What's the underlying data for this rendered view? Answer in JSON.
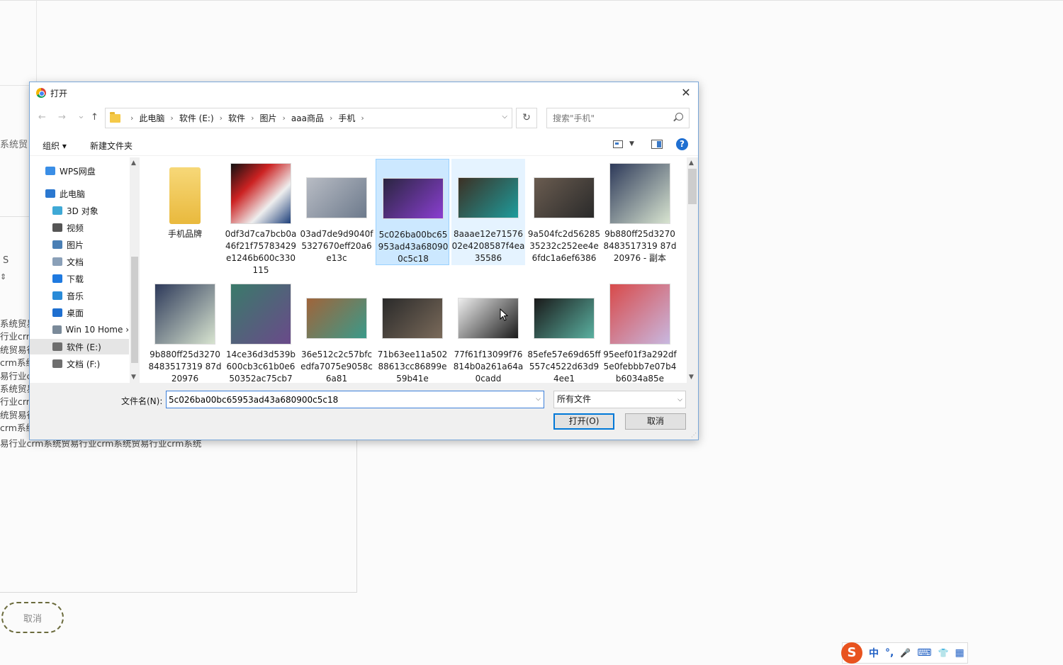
{
  "background": {
    "label_top": "系统贸",
    "s_icon": "S",
    "arrow_icon": "⇕",
    "text_lines": [
      "系统贸易",
      "行业crm",
      "统贸易行",
      "crm系统",
      "易行业c",
      "系统贸易",
      "行业crm",
      "统贸易行",
      "crm系统"
    ],
    "text_full": "易行业crm系统贸易行业crm系统贸易行业crm系统",
    "cancel": "取消"
  },
  "dialog": {
    "title": "打开",
    "close": "✕",
    "nav": {
      "back": "←",
      "forward": "→",
      "recent": "⌄",
      "up": "↑"
    },
    "breadcrumbs": [
      "此电脑",
      "软件 (E:)",
      "软件",
      "图片",
      "aaa商品",
      "手机"
    ],
    "search_placeholder": "搜索\"手机\"",
    "toolbar": {
      "organize": "组织 ▾",
      "new_folder": "新建文件夹",
      "help": "?"
    },
    "nav_pane": [
      {
        "label": "WPS网盘",
        "icon": "cloud-icon",
        "color": "#3a8ee6"
      },
      {
        "label": "此电脑",
        "icon": "computer-icon",
        "color": "#2b78d0"
      },
      {
        "label": "3D 对象",
        "icon": "3d-objects-icon",
        "color": "#3fa9d6"
      },
      {
        "label": "视频",
        "icon": "video-icon",
        "color": "#555555"
      },
      {
        "label": "图片",
        "icon": "pictures-icon",
        "color": "#4a7fb5"
      },
      {
        "label": "文档",
        "icon": "documents-icon",
        "color": "#8aa0b8"
      },
      {
        "label": "下载",
        "icon": "downloads-icon",
        "color": "#1f7ae0"
      },
      {
        "label": "音乐",
        "icon": "music-icon",
        "color": "#2a8bd8"
      },
      {
        "label": "桌面",
        "icon": "desktop-icon",
        "color": "#1e6fd0"
      },
      {
        "label": "Win 10 Home ›",
        "icon": "drive-icon",
        "color": "#7a8a99"
      },
      {
        "label": "软件 (E:)",
        "icon": "drive-icon",
        "color": "#6e6e6e",
        "selected": true
      },
      {
        "label": "文档 (F:)",
        "icon": "drive-icon",
        "color": "#6e6e6e"
      }
    ],
    "files": [
      {
        "name": "手机品牌",
        "kind": "folder",
        "state": ""
      },
      {
        "name": "0df3d7ca7bcb0a46f21f75783429e1246b600c330115",
        "kind": "image",
        "colors": [
          "#111",
          "#c22",
          "#eee",
          "#1d3f7a"
        ],
        "state": ""
      },
      {
        "name": "03ad7de9d9040f5327670eff20a6e13c",
        "kind": "image",
        "colors": [
          "#b8bcc4",
          "#6d7a8c"
        ],
        "state": ""
      },
      {
        "name": "5c026ba00bc65953ad43a680900c5c18",
        "kind": "image",
        "colors": [
          "#2a2540",
          "#8a3fd1"
        ],
        "state": "selected"
      },
      {
        "name": "8aaae12e7157602e4208587f4ea35586",
        "kind": "image",
        "colors": [
          "#3c3024",
          "#1e9c9c"
        ],
        "state": "hover"
      },
      {
        "name": "9a504fc2d5628535232c252ee4e6fdc1a6ef6386",
        "kind": "image",
        "colors": [
          "#6a5c50",
          "#2a2a2a"
        ],
        "state": ""
      },
      {
        "name": "9b880ff25d32708483517319 87d20976 - 副本",
        "kind": "image",
        "colors": [
          "#2e3a5a",
          "#d8e4d0"
        ],
        "state": ""
      },
      {
        "name": "9b880ff25d32708483517319 87d20976",
        "kind": "image",
        "colors": [
          "#2e3a5a",
          "#d8e4d0"
        ],
        "state": ""
      },
      {
        "name": "14ce36d3d539b600cb3c61b0e650352ac75cb7",
        "kind": "image",
        "colors": [
          "#3a7a6a",
          "#6a4a8a"
        ],
        "state": ""
      },
      {
        "name": "36e512c2c57bfcedfa7075e9058c6a81",
        "kind": "image",
        "colors": [
          "#a0643a",
          "#3a9a8a"
        ],
        "state": ""
      },
      {
        "name": "71b63ee11a50288613cc86899e59b41e",
        "kind": "image",
        "colors": [
          "#2a2a2a",
          "#7a6a5a"
        ],
        "state": ""
      },
      {
        "name": "77f61f13099f76814b0a261a64a0cadd",
        "kind": "image",
        "colors": [
          "#eeeeee",
          "#1a1a1a"
        ],
        "state": ""
      },
      {
        "name": "85efe57e69d65ff557c4522d63d94ee1",
        "kind": "image",
        "colors": [
          "#1a1a1a",
          "#5ab0a0"
        ],
        "state": ""
      },
      {
        "name": "95eef01f3a292df5e0febbb7e07b4b6034a85e",
        "kind": "image",
        "colors": [
          "#d84a4a",
          "#c8b8e0"
        ],
        "state": ""
      }
    ],
    "footer": {
      "filename_label": "文件名(N):",
      "filename_value": "5c026ba00bc65953ad43a680900c5c18",
      "filter_value": "所有文件",
      "open_button": "打开(O)",
      "cancel_button": "取消"
    }
  },
  "ime": {
    "logo": "S",
    "items": [
      "中",
      "°,",
      "🎤",
      "⌨",
      "👕",
      "▦"
    ]
  },
  "colors": {
    "accent": "#0078d7",
    "selected_bg": "#cce8ff",
    "hover_bg": "#e5f3ff"
  }
}
